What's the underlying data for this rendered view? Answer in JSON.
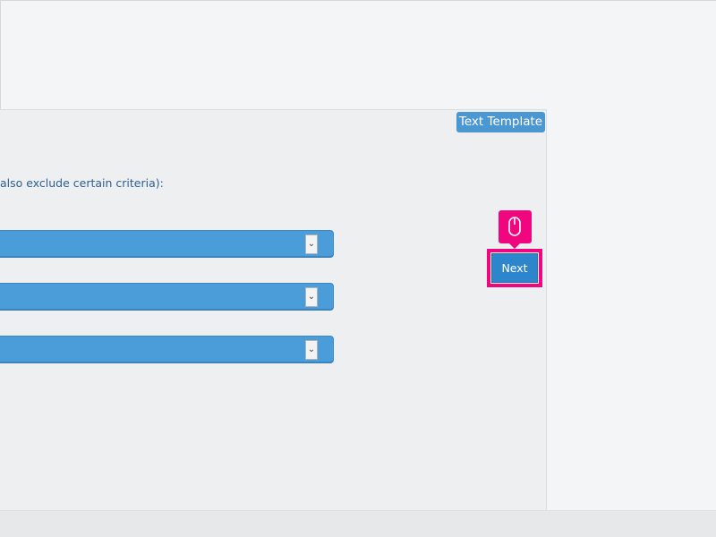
{
  "panel": {
    "template_tab_label": "Text Template",
    "instruction_text": "also exclude certain criteria):"
  },
  "selects": [
    {
      "arrow": "⌄"
    },
    {
      "arrow": "⌄"
    },
    {
      "arrow": "⌄"
    }
  ],
  "actions": {
    "next_label": "Next"
  },
  "icons": {
    "cursor": "mouse-icon"
  },
  "colors": {
    "accent_blue": "#4a9dd9",
    "highlight_pink": "#f0077f",
    "button_blue": "#2d86cc",
    "instruction_text": "#2f5f8f"
  }
}
